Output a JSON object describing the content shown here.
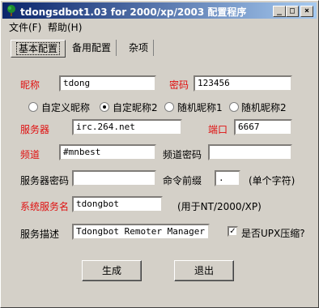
{
  "window": {
    "title": "tdongsdbot1.03 for 2000/xp/2003 配置程序"
  },
  "titlebar_buttons": {
    "minimize": "_",
    "maximize": "□",
    "close": "×"
  },
  "menu": [
    "文件(F)",
    "帮助(H)"
  ],
  "tabs": [
    "基本配置",
    "备用配置",
    "杂项"
  ],
  "form": {
    "nickname": {
      "label": "昵称",
      "value": "tdong"
    },
    "password": {
      "label": "密码",
      "value": "123456"
    },
    "nick_mode": {
      "options": [
        "自定义昵称",
        "自定昵称2",
        "随机昵称1",
        "随机昵称2"
      ],
      "selected": "自定昵称2"
    },
    "server": {
      "label": "服务器",
      "value": "irc.264.net"
    },
    "port": {
      "label": "端口",
      "value": "6667"
    },
    "channel": {
      "label": "频道",
      "value": "#mnbest"
    },
    "channel_password": {
      "label": "频道密码",
      "value": ""
    },
    "server_password": {
      "label": "服务器密码",
      "value": ""
    },
    "command_prefix": {
      "label": "命令前缀",
      "value": ".",
      "hint": "(单个字符)"
    },
    "service_name": {
      "label": "系统服务名",
      "value": "tdongbot",
      "hint": "(用于NT/2000/XP)"
    },
    "service_desc": {
      "label": "服务描述",
      "value": "Tdongbot Remoter Manager"
    },
    "upx": {
      "label": "是否UPX压缩?",
      "checked": true
    }
  },
  "buttons": {
    "generate": "生成",
    "exit": "退出"
  },
  "colors": {
    "title_start": "#0a246a",
    "title_end": "#a6caf0",
    "required_label": "#e01010",
    "face": "#d4d0c8"
  }
}
